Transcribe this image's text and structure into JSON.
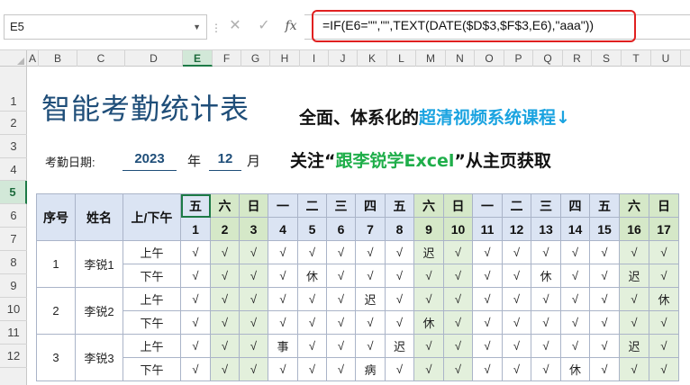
{
  "formula_bar": {
    "name_box": "E5",
    "formula": "=IF(E6=\"\",\"\",TEXT(DATE($D$3,$F$3,E6),\"aaa\"))",
    "cancel_glyph": "✕",
    "enter_glyph": "✓",
    "fx_glyph": "fx"
  },
  "columns": [
    "A",
    "B",
    "C",
    "D",
    "E",
    "F",
    "G",
    "H",
    "I",
    "J",
    "K",
    "L",
    "M",
    "N",
    "O",
    "P",
    "Q",
    "R",
    "S",
    "T",
    "U"
  ],
  "rows": [
    "1",
    "2",
    "3",
    "4",
    "5",
    "6",
    "7",
    "8",
    "9",
    "10",
    "11",
    "12"
  ],
  "sheet": {
    "title": "智能考勤统计表",
    "promo_line1_a": "全面、体系化的",
    "promo_line1_b": "超清视频系统课程↓",
    "promo_line2_a": "关注“",
    "promo_line2_b": "跟李锐学Excel",
    "promo_line2_c": "”从主页获取",
    "date_label": "考勤日期:",
    "year": "2023",
    "year_unit": "年",
    "month": "12",
    "month_unit": "月"
  },
  "table": {
    "headers": {
      "seq": "序号",
      "name": "姓名",
      "shift": "上/下午"
    },
    "weekdays": [
      "五",
      "六",
      "日",
      "一",
      "二",
      "三",
      "四",
      "五",
      "六",
      "日",
      "一",
      "二",
      "三",
      "四",
      "五",
      "六",
      "日"
    ],
    "days": [
      "1",
      "2",
      "3",
      "4",
      "5",
      "6",
      "7",
      "8",
      "9",
      "10",
      "11",
      "12",
      "13",
      "14",
      "15",
      "16",
      "17"
    ],
    "weekend_flags": [
      false,
      true,
      true,
      false,
      false,
      false,
      false,
      false,
      true,
      true,
      false,
      false,
      false,
      false,
      false,
      true,
      true
    ],
    "people": [
      {
        "seq": "1",
        "name": "李锐1",
        "am_label": "上午",
        "am": [
          "√",
          "√",
          "√",
          "√",
          "√",
          "√",
          "√",
          "√",
          "迟",
          "√",
          "√",
          "√",
          "√",
          "√",
          "√",
          "√",
          "√"
        ],
        "pm_label": "下午",
        "pm": [
          "√",
          "√",
          "√",
          "√",
          "休",
          "√",
          "√",
          "√",
          "√",
          "√",
          "√",
          "√",
          "休",
          "√",
          "√",
          "迟",
          "√"
        ]
      },
      {
        "seq": "2",
        "name": "李锐2",
        "am_label": "上午",
        "am": [
          "√",
          "√",
          "√",
          "√",
          "√",
          "√",
          "迟",
          "√",
          "√",
          "√",
          "√",
          "√",
          "√",
          "√",
          "√",
          "√",
          "休"
        ],
        "pm_label": "下午",
        "pm": [
          "√",
          "√",
          "√",
          "√",
          "√",
          "√",
          "√",
          "√",
          "休",
          "√",
          "√",
          "√",
          "√",
          "√",
          "√",
          "√",
          "√"
        ]
      },
      {
        "seq": "3",
        "name": "李锐3",
        "am_label": "上午",
        "am": [
          "√",
          "√",
          "√",
          "事",
          "√",
          "√",
          "√",
          "迟",
          "√",
          "√",
          "√",
          "√",
          "√",
          "√",
          "√",
          "迟",
          "√"
        ],
        "pm_label": "下午",
        "pm": [
          "√",
          "√",
          "√",
          "√",
          "√",
          "√",
          "病",
          "√",
          "√",
          "√",
          "√",
          "√",
          "√",
          "休",
          "√",
          "√",
          "√"
        ]
      }
    ]
  },
  "colors": {
    "accent": "#1d7a46",
    "title_blue": "#1f4e79",
    "promo_blue": "#1aa3e0",
    "promo_green": "#1fae4a",
    "header_fill": "#dbe4f3",
    "weekend_fill": "#e3f0dc",
    "formula_highlight": "#e02020"
  },
  "icons": {
    "name_box_dropdown": "chevron-down-icon",
    "options": "vertical-dots-icon",
    "cancel": "close-icon",
    "enter": "check-icon",
    "function": "fx-icon"
  },
  "selected_cell": "E5"
}
